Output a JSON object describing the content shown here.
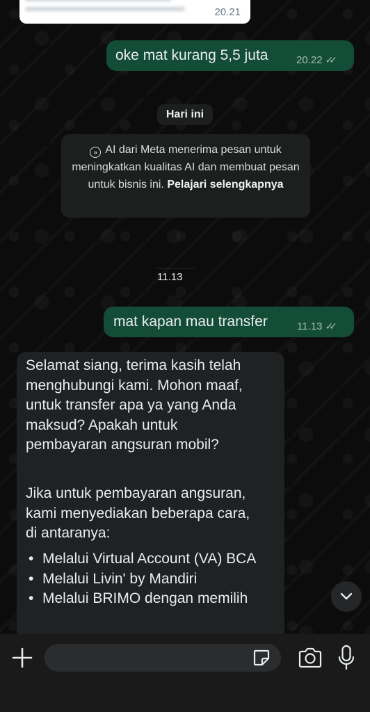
{
  "messages": {
    "prev_partial": {
      "time": "20.21"
    },
    "out1": {
      "text": "oke mat kurang 5,5 juta",
      "time": "20.22"
    },
    "date_chip": "Hari ini",
    "notice": {
      "text": "AI dari Meta menerima pesan untuk meningkatkan kualitas AI dan membuat pesan untuk bisnis ini.",
      "link": "Pelajari selengkapnya"
    },
    "stamp": "11.13",
    "out2": {
      "text": "mat kapan mau transfer",
      "time": "11.13"
    },
    "in1": {
      "lines": [
        "Selamat siang, terima kasih telah",
        "menghubungi kami. Mohon maaf,",
        "untuk transfer apa ya yang Anda",
        "maksud? Apakah untuk",
        "pembayaran angsuran mobil?"
      ],
      "lines2": [
        "Jika untuk pembayaran angsuran,",
        "kami menyediakan beberapa cara,",
        "di antaranya:"
      ],
      "bullets": [
        "Melalui Virtual Account (VA) BCA",
        "Melalui Livin' by Mandiri",
        "Melalui BRIMO dengan memilih"
      ]
    }
  },
  "icons": {
    "scroll_down": "chevron-down-icon",
    "attach": "plus-icon",
    "sticker": "sticker-icon",
    "camera": "camera-icon",
    "mic": "microphone-icon"
  },
  "colors": {
    "outgoing_bubble": "#144d37",
    "incoming_bubble": "#1f2123",
    "background": "#0c0c0c"
  }
}
